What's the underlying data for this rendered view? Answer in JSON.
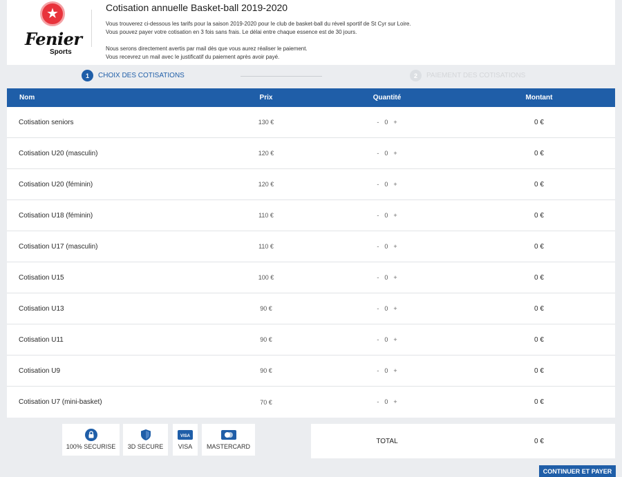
{
  "header": {
    "logo_word": "Fenier",
    "logo_sub": "Sports",
    "title": "Cotisation annuelle Basket-ball 2019-2020",
    "desc_lines": [
      "Vous trouverez ci-dessous les tarifs pour la saison 2019-2020 pour le club de basket-ball du réveil sportif de St Cyr sur Loire.",
      "Vous pouvez payer votre cotisation en 3 fois sans frais. Le délai entre chaque essence est de 30 jours.",
      "Nous serons directement avertis par mail dès que vous aurez réaliser le paiement.",
      "Vous recevrez un mail avec le justificatif du paiement après avoir payé."
    ]
  },
  "steps": [
    {
      "num": "1",
      "label": "CHOIX DES COTISATIONS"
    },
    {
      "num": "2",
      "label": "PAIEMENT DES COTISATIONS"
    }
  ],
  "table": {
    "headers": {
      "nom": "Nom",
      "prix": "Prix",
      "quantite": "Quantité",
      "montant": "Montant"
    },
    "rows": [
      {
        "nom": "Cotisation seniors",
        "prix": "130 €",
        "minus": "-",
        "qty": "0",
        "plus": "+",
        "montant": "0 €"
      },
      {
        "nom": "Cotisation U20 (masculin)",
        "prix": "120 €",
        "minus": "-",
        "qty": "0",
        "plus": "+",
        "montant": "0 €"
      },
      {
        "nom": "Cotisation U20 (féminin)",
        "prix": "120 €",
        "minus": "-",
        "qty": "0",
        "plus": "+",
        "montant": "0 €"
      },
      {
        "nom": "Cotisation U18 (féminin)",
        "prix": "110 €",
        "minus": "-",
        "qty": "0",
        "plus": "+",
        "montant": "0 €"
      },
      {
        "nom": "Cotisation U17 (masculin)",
        "prix": "110 €",
        "minus": "-",
        "qty": "0",
        "plus": "+",
        "montant": "0 €"
      },
      {
        "nom": "Cotisation U15",
        "prix": "100 €",
        "minus": "-",
        "qty": "0",
        "plus": "+",
        "montant": "0 €"
      },
      {
        "nom": "Cotisation U13",
        "prix": "90 €",
        "minus": "-",
        "qty": "0",
        "plus": "+",
        "montant": "0 €"
      },
      {
        "nom": "Cotisation U11",
        "prix": "90 €",
        "minus": "-",
        "qty": "0",
        "plus": "+",
        "montant": "0 €"
      },
      {
        "nom": "Cotisation U9",
        "prix": "90 €",
        "minus": "-",
        "qty": "0",
        "plus": "+",
        "montant": "0 €"
      },
      {
        "nom": "Cotisation U7 (mini-basket)",
        "prix": "70 €",
        "minus": "-",
        "qty": "0",
        "plus": "+",
        "montant": "0 €"
      }
    ]
  },
  "badges": [
    {
      "label": "100% SECURISE",
      "icon": "lock-icon"
    },
    {
      "label": "3D SECURE",
      "icon": "shield-icon"
    },
    {
      "label": "VISA",
      "icon": "visa-card-icon",
      "icon_text": "VISA"
    },
    {
      "label": "MASTERCARD",
      "icon": "mastercard-icon"
    }
  ],
  "total": {
    "label": "TOTAL",
    "value": "0 €"
  },
  "cta_label": "CONTINUER ET PAYER",
  "colors": {
    "primary": "#1f5ea8",
    "logo_red": "#e8333c",
    "background": "#ebedf0"
  }
}
